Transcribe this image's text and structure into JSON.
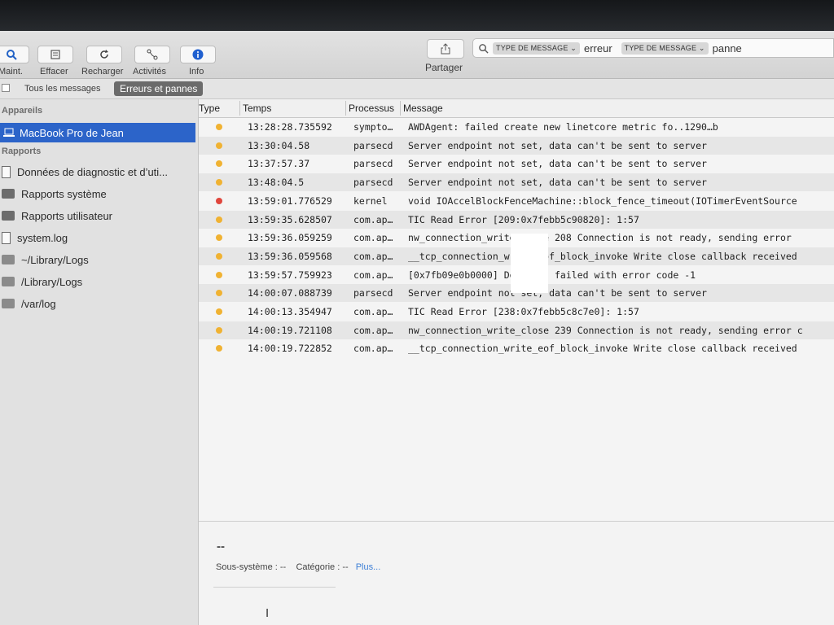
{
  "toolbar": {
    "buttons": [
      {
        "label": "Maint.",
        "icon": "magnifier-icon"
      },
      {
        "label": "Effacer",
        "icon": "clear-icon"
      },
      {
        "label": "Recharger",
        "icon": "reload-icon"
      },
      {
        "label": "Activités",
        "icon": "activity-icon"
      },
      {
        "label": "Info",
        "icon": "info-icon"
      }
    ],
    "share_label": "Partager"
  },
  "search": {
    "tokens": [
      {
        "field": "TYPE DE MESSAGE ⌄",
        "term": "erreur"
      },
      {
        "field": "TYPE DE MESSAGE ⌄",
        "term": "panne"
      }
    ]
  },
  "scope": {
    "all_messages": "Tous les messages",
    "errors_faults": "Erreurs et pannes"
  },
  "sidebar": {
    "devices_header": "Appareils",
    "device": "MacBook Pro de Jean",
    "reports_header": "Rapports",
    "items": [
      {
        "label": "Données de diagnostic et d’uti...",
        "icon": "document-icon"
      },
      {
        "label": "Rapports système",
        "icon": "folder-icon"
      },
      {
        "label": "Rapports utilisateur",
        "icon": "folder-icon"
      },
      {
        "label": "system.log",
        "icon": "document-icon"
      },
      {
        "label": "~/Library/Logs",
        "icon": "folder-icon"
      },
      {
        "label": "/Library/Logs",
        "icon": "folder-icon"
      },
      {
        "label": "/var/log",
        "icon": "folder-icon"
      }
    ]
  },
  "table": {
    "columns": [
      "Type",
      "Temps",
      "Processus",
      "Message"
    ],
    "rows": [
      {
        "level": "error",
        "time": "13:28:28.735592",
        "process": "sympto…",
        "message": "AWDAgent: failed create new linetcore metric fo..1290…b"
      },
      {
        "level": "error",
        "time": "13:30:04.58",
        "process": "parsecd",
        "message": "Server endpoint not set, data can't be sent to server"
      },
      {
        "level": "error",
        "time": "13:37:57.37",
        "process": "parsecd",
        "message": "Server endpoint not set, data can't be sent to server"
      },
      {
        "level": "error",
        "time": "13:48:04.5",
        "process": "parsecd",
        "message": "Server endpoint not set, data can't be sent to server"
      },
      {
        "level": "fault",
        "time": "13:59:01.776529",
        "process": "kernel",
        "message": "void IOAccelBlockFenceMachine::block_fence_timeout(IOTimerEventSource"
      },
      {
        "level": "error",
        "time": "13:59:35.628507",
        "process": "com.ap…",
        "message": "TIC Read Error [209:0x7febb5c90820]: 1:57"
      },
      {
        "level": "error",
        "time": "13:59:36.059259",
        "process": "com.ap…",
        "message": "nw_connection_write_close 208 Connection is not ready, sending error"
      },
      {
        "level": "error",
        "time": "13:59:36.059568",
        "process": "com.ap…",
        "message": "__tcp_connection_write_eof_block_invoke Write close callback received"
      },
      {
        "level": "error",
        "time": "13:59:57.759923",
        "process": "com.ap…",
        "message": "[0x7fb09e0b0000] Decoding failed with error code -1"
      },
      {
        "level": "error",
        "time": "14:00:07.088739",
        "process": "parsecd",
        "message": "Server endpoint not set, data can't be sent to server"
      },
      {
        "level": "error",
        "time": "14:00:13.354947",
        "process": "com.ap…",
        "message": "TIC Read Error [238:0x7febb5c8c7e0]: 1:57"
      },
      {
        "level": "error",
        "time": "14:00:19.721108",
        "process": "com.ap…",
        "message": "nw_connection_write_close 239 Connection is not ready, sending error c"
      },
      {
        "level": "error",
        "time": "14:00:19.722852",
        "process": "com.ap…",
        "message": "__tcp_connection_write_eof_block_invoke Write close callback received"
      }
    ]
  },
  "detail": {
    "title": "--",
    "subsystem_label": "Sous-système :",
    "subsystem_value": "--",
    "category_label": "Catégorie :",
    "category_value": "--",
    "more_link": "Plus..."
  },
  "colors": {
    "error": "#f0b232",
    "fault": "#e0463c",
    "selection": "#2c64c9",
    "link": "#3e7fd6"
  }
}
